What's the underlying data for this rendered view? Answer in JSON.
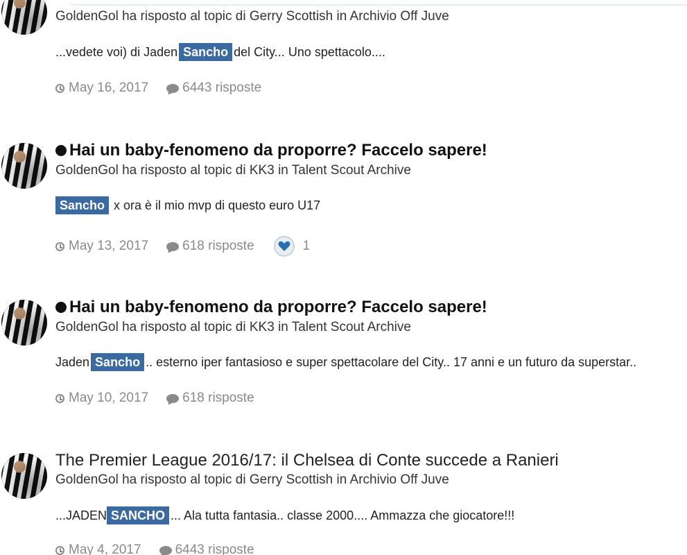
{
  "posts": [
    {
      "title": "",
      "byline": "GoldenGol ha risposto al topic di Gerry Scottish in Archivio Off Juve",
      "snippet": {
        "before": "...vedete voi) di Jaden",
        "highlight": "Sancho",
        "after": "del City... Uno spettacolo...."
      },
      "date": "May 16, 2017",
      "replies": "6443 risposte"
    },
    {
      "title": "Hai un baby-fenomeno da proporre? Faccelo sapere!",
      "byline": "GoldenGol ha risposto al topic di KK3 in Talent Scout Archive",
      "snippet": {
        "before": "",
        "highlight": "Sancho",
        "after": "x ora è il mio mvp di questo euro U17"
      },
      "date": "May 13, 2017",
      "replies": "618 risposte",
      "likes": "1"
    },
    {
      "title": "Hai un baby-fenomeno da proporre? Faccelo sapere!",
      "byline": "GoldenGol ha risposto al topic di KK3 in Talent Scout Archive",
      "snippet": {
        "before": "Jaden",
        "highlight": "Sancho",
        "after": ".. esterno iper fantasioso e super spettacolare del City.. 17 anni e un futuro da superstar.."
      },
      "date": "May 10, 2017",
      "replies": "618 risposte"
    },
    {
      "title": "The Premier League 2016/17: il Chelsea di Conte succede a Ranieri",
      "byline": "GoldenGol ha risposto al topic di Gerry Scottish in Archivio Off Juve",
      "snippet": {
        "before": "...JADEN",
        "highlight": "SANCHO",
        "after": "... Ala tutta fantasia.. classe 2000.... Ammazza che giocatore!!!"
      },
      "date": "May 4, 2017",
      "replies": "6443 risposte"
    }
  ],
  "colors": {
    "highlight": "#3b6aa0",
    "meta": "#8a8a8a",
    "like": "#2c6fb0"
  },
  "icons": {
    "unread": "unread-dot-icon",
    "date": "clock-icon",
    "replies": "comment-icon",
    "like": "heart-icon"
  }
}
